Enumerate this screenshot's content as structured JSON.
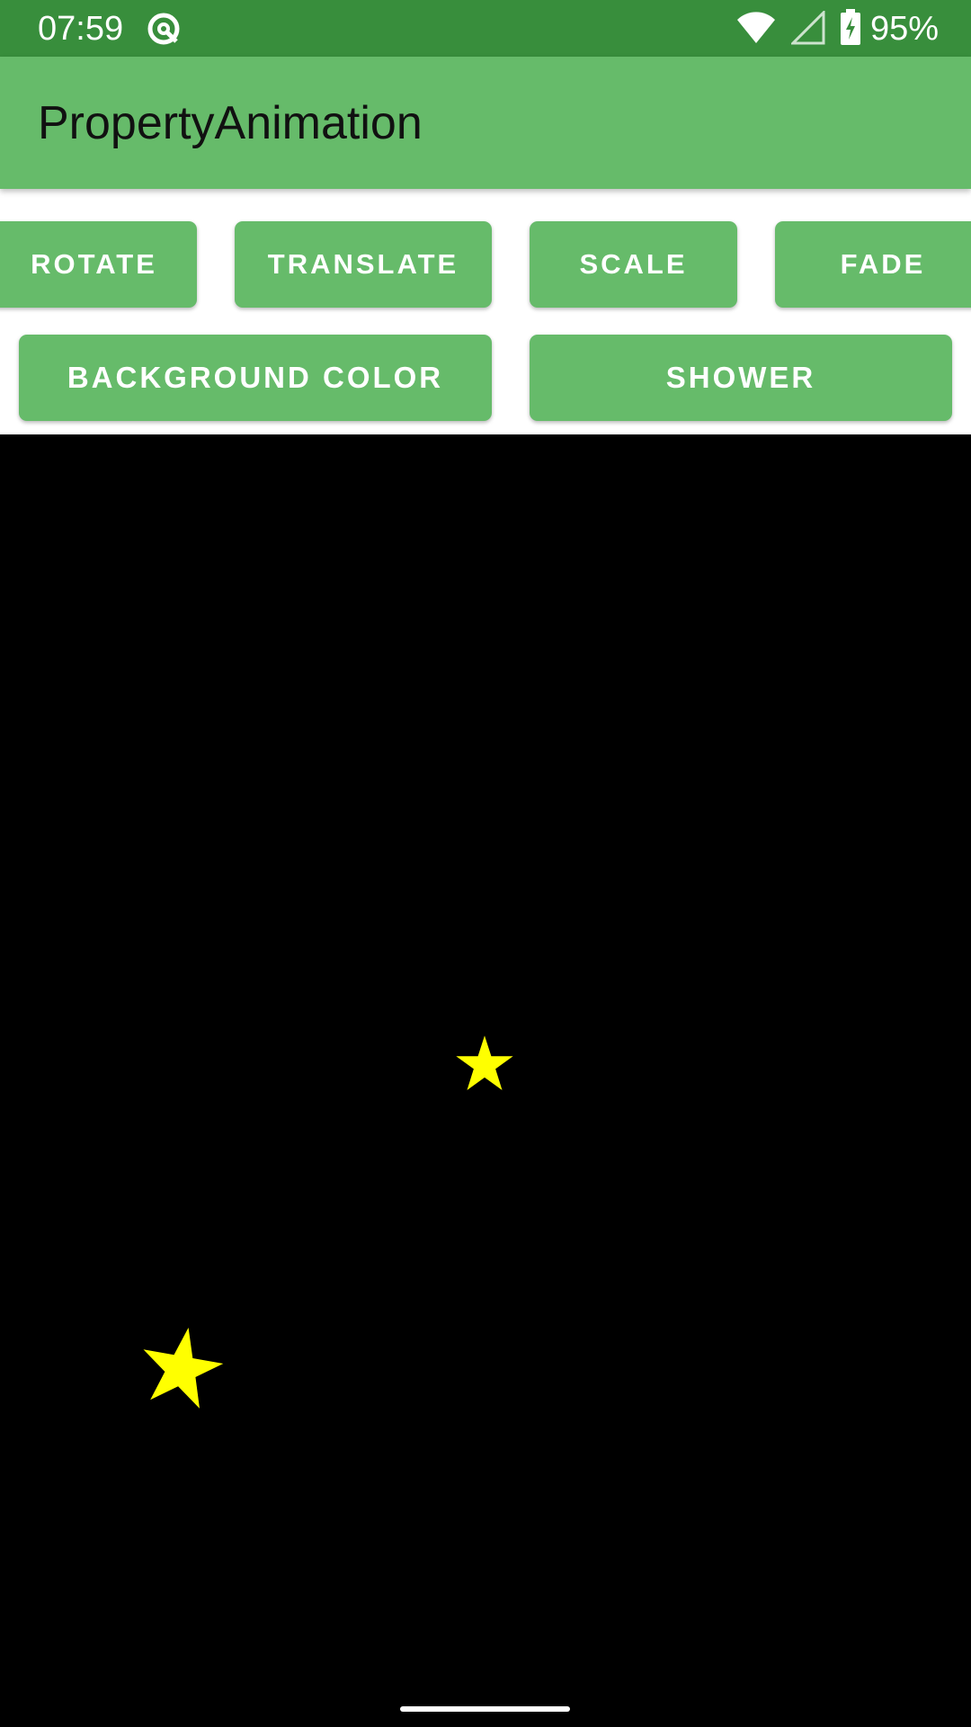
{
  "status_bar": {
    "time": "07:59",
    "battery": "95%",
    "icons": [
      "app-notification-icon",
      "wifi-icon",
      "cell-signal-icon",
      "battery-charging-icon"
    ],
    "background_color": "#388e3c"
  },
  "app_bar": {
    "title": "PropertyAnimation",
    "background_color": "#66bb6a"
  },
  "buttons": {
    "rotate": "ROTATE",
    "translate": "TRANSLATE",
    "scale": "SCALE",
    "fade": "FADE",
    "background_color": "BACKGROUND COLOR",
    "shower": "SHOWER",
    "color": "#66bb6a"
  },
  "canvas": {
    "background_color": "#000000",
    "stars": [
      {
        "name": "star-icon",
        "color": "#ffff00"
      },
      {
        "name": "star-icon",
        "color": "#ffff00"
      }
    ]
  }
}
